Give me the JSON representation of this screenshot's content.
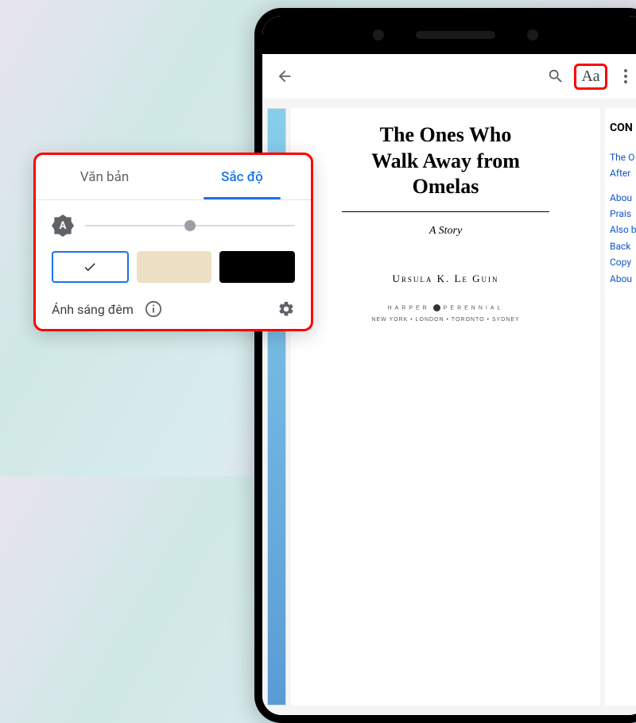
{
  "appbar": {
    "aa_label": "Aa"
  },
  "book": {
    "title_line1": "The Ones Who",
    "title_line2": "Walk Away from",
    "title_line3": "Omelas",
    "subtitle": "A Story",
    "author": "Ursula K. Le Guin",
    "publisher_left": "HARPER",
    "publisher_right": "PERENNIAL",
    "cities": "NEW YORK • LONDON • TORONTO • SYDNEY"
  },
  "toc": {
    "heading": "CON",
    "items": [
      "The O",
      "After",
      "Abou",
      "Prais",
      "Also b",
      "Back",
      "Copy",
      "Abou"
    ]
  },
  "popup": {
    "tab_text": "Văn bản",
    "tab_brightness": "Sắc độ",
    "auto_badge": "A",
    "night_label": "Ánh sáng đêm"
  }
}
